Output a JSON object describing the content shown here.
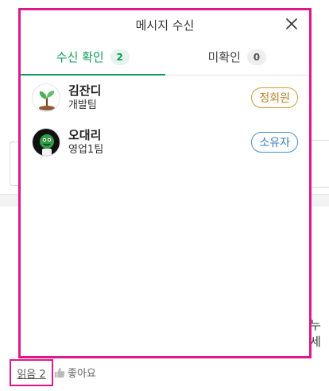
{
  "popup": {
    "title": "메시지 수신",
    "close_icon": "close-icon"
  },
  "tabs": [
    {
      "label": "수신 확인",
      "count": "2",
      "active": true
    },
    {
      "label": "미확인",
      "count": "0",
      "active": false
    }
  ],
  "members": [
    {
      "name": "김잔디",
      "team": "개발팀",
      "role": "정회원",
      "avatar_icon": "sprout-avatar-icon"
    },
    {
      "name": "오대리",
      "team": "영업1팀",
      "role": "소유자",
      "avatar_icon": "character-avatar-icon"
    }
  ],
  "footer": {
    "read_count_label": "읽음 2",
    "like_label": "좋아요",
    "trailing_text": "누세"
  },
  "colors": {
    "accent_green": "#0f9a5c",
    "highlight_pink": "#e0198a",
    "regular_badge": "#d09a3a",
    "owner_badge": "#4a90c9"
  }
}
